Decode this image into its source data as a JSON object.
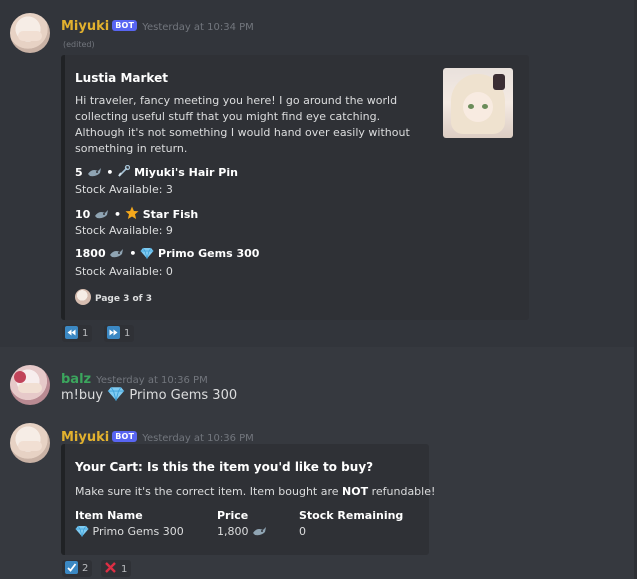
{
  "messages": {
    "m1": {
      "username": "Miyuki",
      "bot_tag": "BOT",
      "timestamp": "Yesterday at 10:34 PM",
      "edited": "(edited)",
      "embed": {
        "title": "Lustia Market",
        "description": "Hi traveler, fancy meeting you here! I go around the world collecting useful stuff that you might find eye catching. Although it's not something I would hand over easily without something in return.",
        "items": [
          {
            "price": "5",
            "separator": "•",
            "name": "Miyuki's Hair Pin",
            "icon": "safety-pin-icon",
            "stock": "Stock Available: 3"
          },
          {
            "price": "10",
            "separator": "•",
            "name": "Star Fish",
            "icon": "star-icon",
            "stock": "Stock Available: 9"
          },
          {
            "price": "1800",
            "separator": "•",
            "name": "Primo Gems 300",
            "icon": "gem-icon",
            "stock": "Stock Available: 0"
          }
        ],
        "footer": "Page 3 of 3"
      },
      "reactions": [
        {
          "icon": "rewind-icon",
          "count": "1"
        },
        {
          "icon": "fast-forward-icon",
          "count": "1"
        }
      ]
    },
    "m2": {
      "username": "balz",
      "timestamp": "Yesterday at 10:36 PM",
      "text_prefix": "m!buy",
      "text_suffix": "Primo Gems 300"
    },
    "m3": {
      "username": "Miyuki",
      "bot_tag": "BOT",
      "timestamp": "Yesterday at 10:36 PM",
      "embed": {
        "title": "Your Cart: Is this the item you'd like to buy?",
        "desc_before": "Make sure it's the correct item. Item bought are",
        "desc_bold": "NOT",
        "desc_after": "refundable!",
        "fields": [
          {
            "name": "Item Name",
            "value": "Primo Gems 300"
          },
          {
            "name": "Price",
            "value": "1,800"
          },
          {
            "name": "Stock Remaining",
            "value": "0"
          }
        ]
      },
      "reactions": [
        {
          "icon": "check-mark-icon",
          "count": "2"
        },
        {
          "icon": "cross-mark-icon",
          "count": "1"
        }
      ]
    }
  },
  "colors": {
    "background": "#36393f",
    "embed_bg": "#2f3136",
    "miyuki_name": "#e2b12e",
    "balz_name": "#3ba55d",
    "bot_tag": "#5865f2",
    "reaction_blue": "#3b88c3"
  }
}
